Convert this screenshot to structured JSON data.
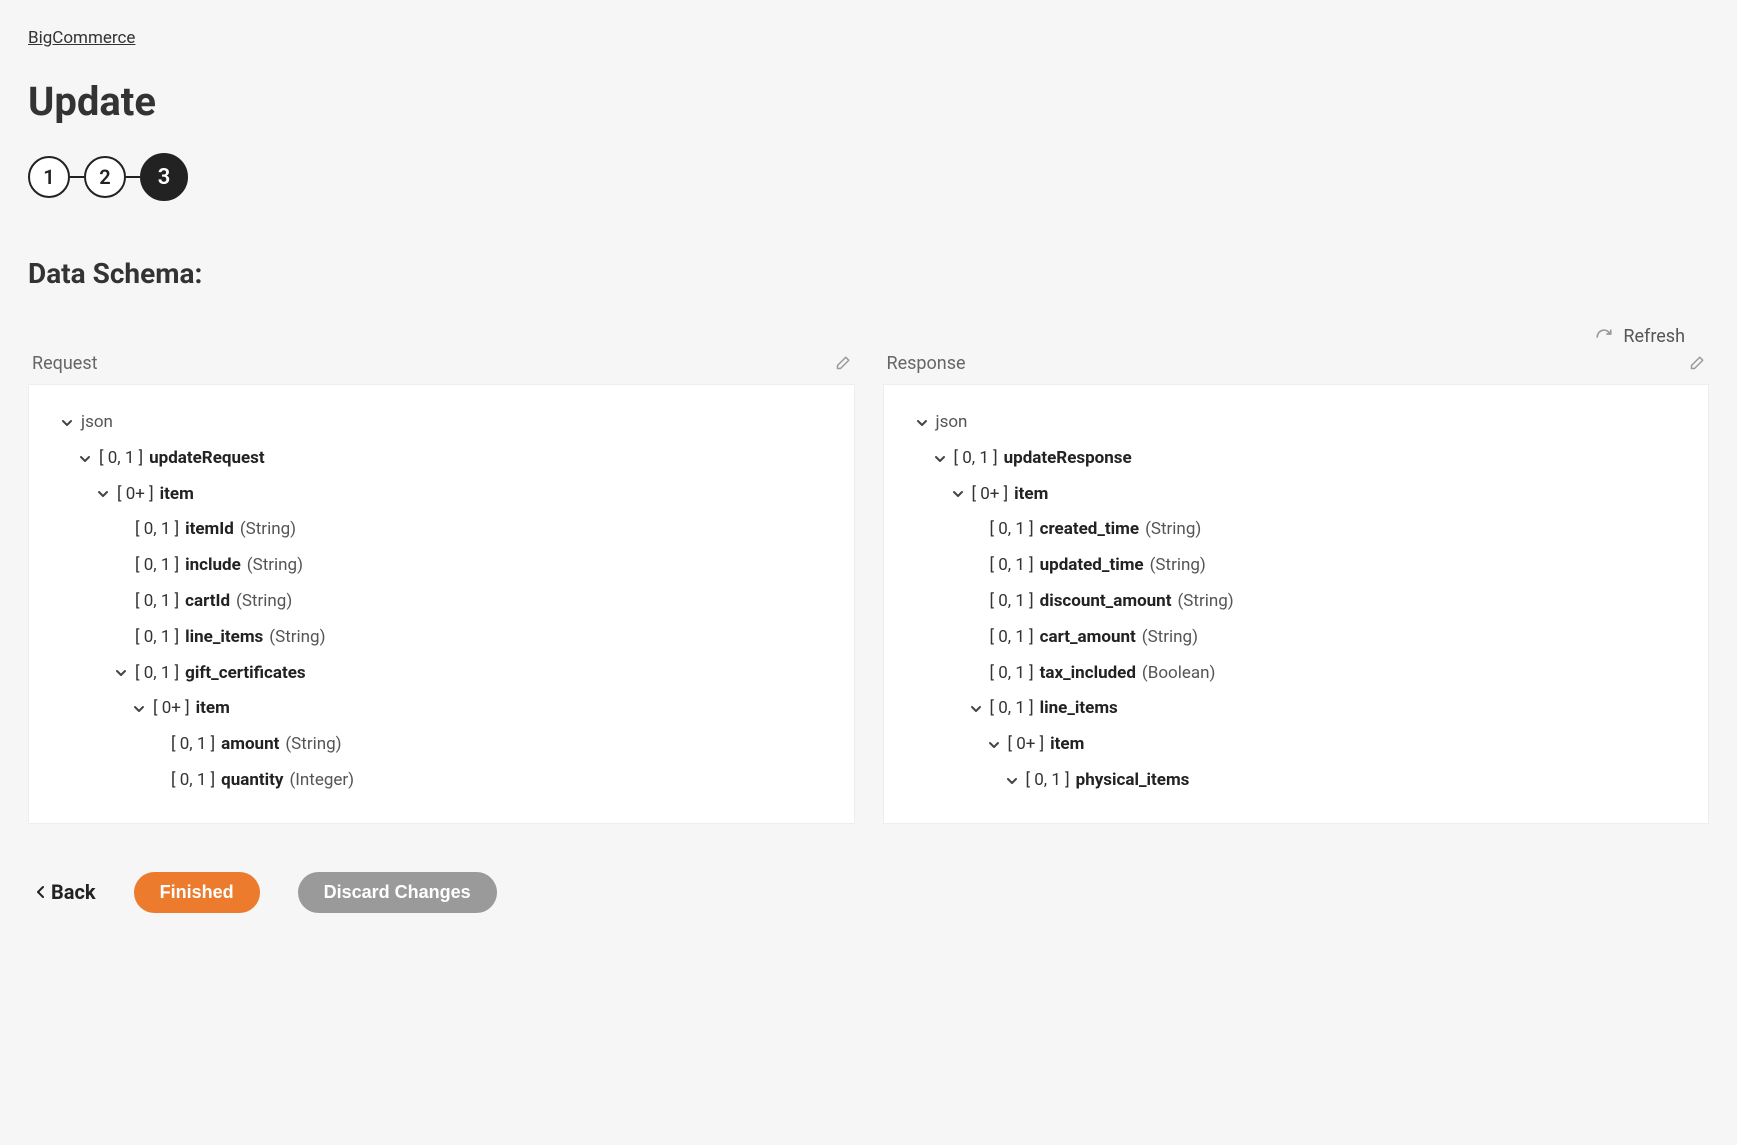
{
  "breadcrumb": "BigCommerce",
  "title": "Update",
  "stepper": {
    "steps": [
      "1",
      "2",
      "3"
    ],
    "activeIndex": 2
  },
  "sectionHeading": "Data Schema:",
  "refreshLabel": "Refresh",
  "request": {
    "label": "Request",
    "tree": [
      {
        "depth": 0,
        "chevron": true,
        "name": "json",
        "bold": false
      },
      {
        "depth": 1,
        "chevron": true,
        "cardinality": "[ 0, 1 ]",
        "name": "updateRequest"
      },
      {
        "depth": 2,
        "chevron": true,
        "cardinality": "[ 0+ ]",
        "name": "item"
      },
      {
        "depth": 3,
        "chevron": false,
        "cardinality": "[ 0, 1 ]",
        "name": "itemId",
        "type": "(String)"
      },
      {
        "depth": 3,
        "chevron": false,
        "cardinality": "[ 0, 1 ]",
        "name": "include",
        "type": "(String)"
      },
      {
        "depth": 3,
        "chevron": false,
        "cardinality": "[ 0, 1 ]",
        "name": "cartId",
        "type": "(String)"
      },
      {
        "depth": 3,
        "chevron": false,
        "cardinality": "[ 0, 1 ]",
        "name": "line_items",
        "type": "(String)"
      },
      {
        "depth": 3,
        "chevron": true,
        "cardinality": "[ 0, 1 ]",
        "name": "gift_certificates"
      },
      {
        "depth": 4,
        "chevron": true,
        "cardinality": "[ 0+ ]",
        "name": "item"
      },
      {
        "depth": 5,
        "chevron": false,
        "cardinality": "[ 0, 1 ]",
        "name": "amount",
        "type": "(String)"
      },
      {
        "depth": 5,
        "chevron": false,
        "cardinality": "[ 0, 1 ]",
        "name": "quantity",
        "type": "(Integer)"
      }
    ]
  },
  "response": {
    "label": "Response",
    "tree": [
      {
        "depth": 0,
        "chevron": true,
        "name": "json",
        "bold": false
      },
      {
        "depth": 1,
        "chevron": true,
        "cardinality": "[ 0, 1 ]",
        "name": "updateResponse"
      },
      {
        "depth": 2,
        "chevron": true,
        "cardinality": "[ 0+ ]",
        "name": "item"
      },
      {
        "depth": 3,
        "chevron": false,
        "cardinality": "[ 0, 1 ]",
        "name": "created_time",
        "type": "(String)"
      },
      {
        "depth": 3,
        "chevron": false,
        "cardinality": "[ 0, 1 ]",
        "name": "updated_time",
        "type": "(String)"
      },
      {
        "depth": 3,
        "chevron": false,
        "cardinality": "[ 0, 1 ]",
        "name": "discount_amount",
        "type": "(String)"
      },
      {
        "depth": 3,
        "chevron": false,
        "cardinality": "[ 0, 1 ]",
        "name": "cart_amount",
        "type": "(String)"
      },
      {
        "depth": 3,
        "chevron": false,
        "cardinality": "[ 0, 1 ]",
        "name": "tax_included",
        "type": "(Boolean)"
      },
      {
        "depth": 3,
        "chevron": true,
        "cardinality": "[ 0, 1 ]",
        "name": "line_items"
      },
      {
        "depth": 4,
        "chevron": true,
        "cardinality": "[ 0+ ]",
        "name": "item"
      },
      {
        "depth": 5,
        "chevron": true,
        "cardinality": "[ 0, 1 ]",
        "name": "physical_items"
      }
    ]
  },
  "footer": {
    "back": "Back",
    "finished": "Finished",
    "discard": "Discard Changes"
  }
}
